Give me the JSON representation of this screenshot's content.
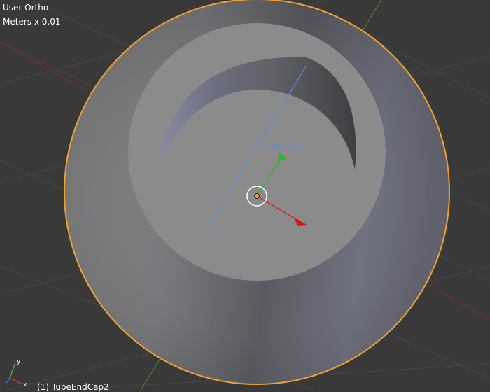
{
  "viewport": {
    "view_mode": "User Ortho",
    "unit_scale": "Meters x 0.01",
    "object_label": "(1) TubeEndCap2",
    "measurement": "25.00 mm",
    "axis_labels": {
      "x": "x",
      "y": "y"
    }
  },
  "colors": {
    "background": "#393939",
    "grid": "#474747",
    "x_axis": "#8a2a2a",
    "y_axis": "#4e8a2a",
    "selection_outline": "#f0a030",
    "ruler": "#5b8fd6",
    "gizmo_x": "#dd1111",
    "gizmo_y": "#22bb22"
  },
  "icons": [
    "transform-gizmo-icon",
    "origin-point-icon",
    "axis-orientation-icon"
  ]
}
